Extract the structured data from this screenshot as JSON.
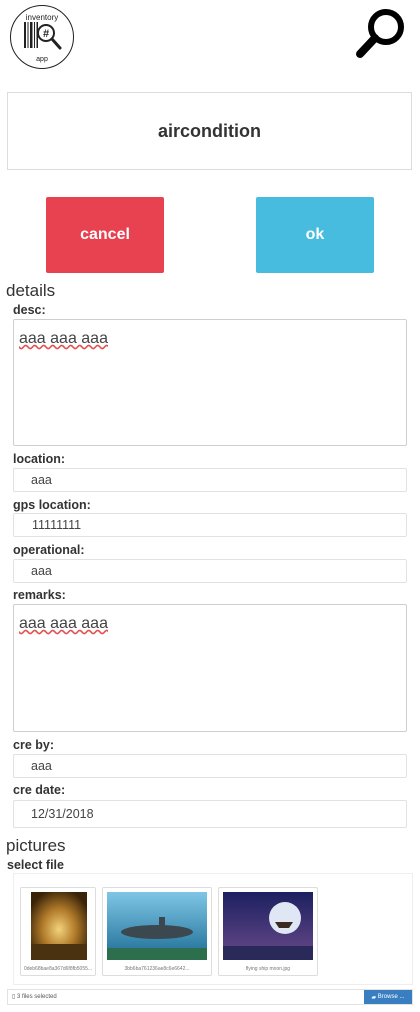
{
  "header": {
    "logo_top": "inventory",
    "logo_bottom": "app",
    "logo_symbol": "#",
    "search_icon": "magnifier-icon"
  },
  "item": {
    "title": "aircondition"
  },
  "actions": {
    "cancel_label": "cancel",
    "ok_label": "ok"
  },
  "details": {
    "heading": "details",
    "fields": {
      "desc": {
        "label": "desc:",
        "value": "aaa aaa aaa"
      },
      "location": {
        "label": "location:",
        "value": "aaa"
      },
      "gps": {
        "label": "gps location:",
        "value": "11111111"
      },
      "operational": {
        "label": "operational:",
        "value": "aaa"
      },
      "remarks": {
        "label": "remarks:",
        "value": "aaa aaa aaa"
      },
      "cre_by": {
        "label": "cre by:",
        "value": "aaa"
      },
      "cre_date": {
        "label": "cre date:",
        "value": "12/31/2018"
      }
    }
  },
  "pictures": {
    "heading": "pictures",
    "select_label": "select file",
    "files": [
      {
        "caption": "0deb68bae8a367d6f8fb5055..."
      },
      {
        "caption": "3bb6ba761236ae8c6e6642..."
      },
      {
        "caption": "flying ship moon.jpg"
      }
    ],
    "status": "3 files selected",
    "browse_label": "Browse ..."
  }
}
